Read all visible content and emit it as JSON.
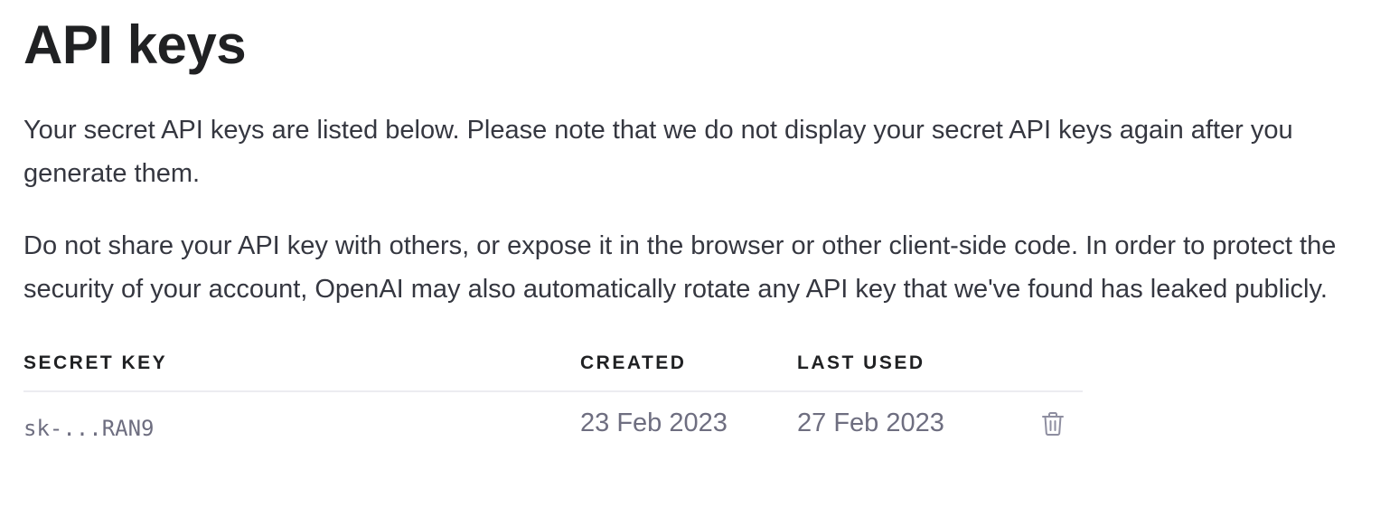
{
  "page": {
    "title": "API keys",
    "intro_paragraph": "Your secret API keys are listed below. Please note that we do not display your secret API keys again after you generate them.",
    "warning_paragraph": "Do not share your API key with others, or expose it in the browser or other client-side code. In order to protect the security of your account, OpenAI may also automatically rotate any API key that we've found has leaked publicly."
  },
  "table": {
    "headers": {
      "secret_key": "SECRET KEY",
      "created": "CREATED",
      "last_used": "LAST USED"
    },
    "rows": [
      {
        "secret_key": "sk-...RAN9",
        "created": "23 Feb 2023",
        "last_used": "27 Feb 2023",
        "action_icon": "trash-icon"
      }
    ]
  },
  "colors": {
    "text_primary": "#202123",
    "text_secondary": "#6e6e80",
    "divider": "#ececf1"
  }
}
